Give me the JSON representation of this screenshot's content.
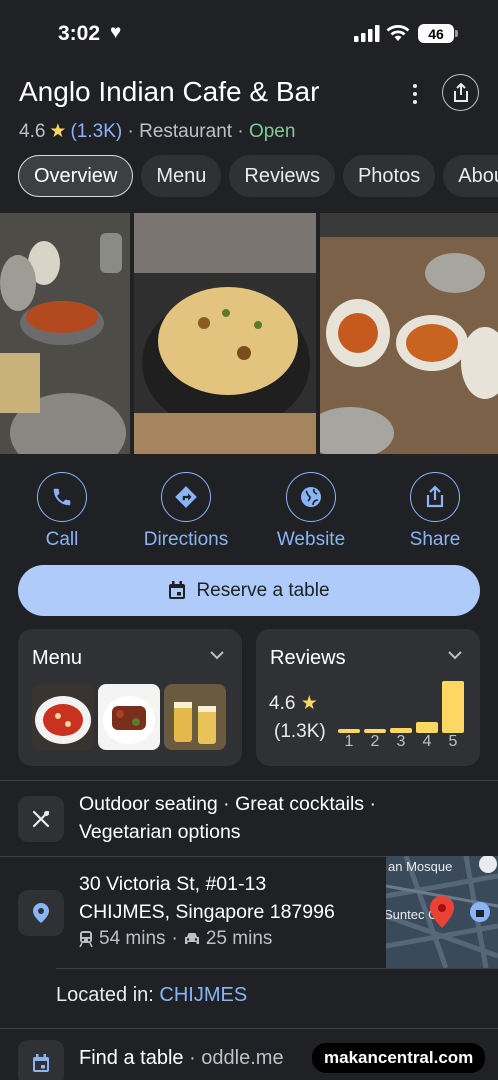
{
  "status": {
    "time": "3:02",
    "battery": "46"
  },
  "place": {
    "name": "Anglo Indian Cafe & Bar",
    "rating": "4.6",
    "review_count": "(1.3K)",
    "sep1": " · ",
    "category": "Restaurant",
    "sep2": " · ",
    "open_status": "Open"
  },
  "tabs": [
    {
      "label": "Overview",
      "active": true
    },
    {
      "label": "Menu"
    },
    {
      "label": "Reviews"
    },
    {
      "label": "Photos"
    },
    {
      "label": "Abou"
    }
  ],
  "actions": [
    {
      "label": "Call",
      "icon": "phone-icon"
    },
    {
      "label": "Directions",
      "icon": "directions-icon"
    },
    {
      "label": "Website",
      "icon": "globe-icon"
    },
    {
      "label": "Share",
      "icon": "share-icon"
    }
  ],
  "reserve": {
    "label": "Reserve a table",
    "icon": "calendar-icon"
  },
  "menu_card": {
    "title": "Menu"
  },
  "reviews_card": {
    "title": "Reviews",
    "rating": "4.6",
    "count": "(1.3K)",
    "distribution": [
      {
        "label": "1",
        "fraction": 0.07
      },
      {
        "label": "2",
        "fraction": 0.07
      },
      {
        "label": "3",
        "fraction": 0.1
      },
      {
        "label": "4",
        "fraction": 0.22
      },
      {
        "label": "5",
        "fraction": 1.0
      }
    ]
  },
  "features": "Outdoor seating · Great cocktails · Vegetarian options",
  "address": {
    "line1": "30 Victoria St, #01-13",
    "line2": "CHIJMES, Singapore 187996",
    "transit_time": "54 mins",
    "sep": "·",
    "drive_time": "25 mins"
  },
  "map": {
    "label1": "an Mosque",
    "label2": "Suntec Cty"
  },
  "located_in": {
    "prefix": "Located in: ",
    "place": "CHIJMES"
  },
  "find_table": {
    "label": "Find a table",
    "sep": " · ",
    "provider": "oddle.me"
  },
  "watermark": "makancentral.com",
  "colors": {
    "accent": "#8ab4f8",
    "star": "#fdd663",
    "open": "#81c995",
    "reserve_bg": "#aecbfa",
    "background": "#202124"
  }
}
